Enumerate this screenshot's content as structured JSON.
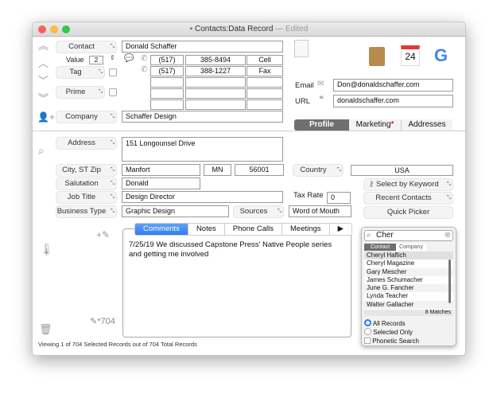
{
  "window": {
    "title": "Contacts:Data Record",
    "edited": "— Edited"
  },
  "nav": {
    "value_label": "Value",
    "value": "2"
  },
  "fields": {
    "contact_label": "Contact",
    "contact": "Donald Schaffer",
    "tag_label": "Tag",
    "prime_label": "Prime",
    "company_label": "Company",
    "company": "Schaffer Design",
    "phones": [
      {
        "area": "(517)",
        "number": "385-8494",
        "type": "Cell"
      },
      {
        "area": "(517)",
        "number": "388-1227",
        "type": "Fax"
      }
    ],
    "email_label": "Email",
    "email": "Don@donaldschaffer.com",
    "url_label": "URL",
    "url": "donaldschaffer.com",
    "address_label": "Address",
    "address": "151 Longounsel Drive",
    "city_label": "City, ST Zip",
    "city": "Manfort",
    "state": "MN",
    "zip": "56001",
    "country_label": "Country",
    "country": "USA",
    "salutation_label": "Salutation",
    "salutation": "Donald",
    "jobtitle_label": "Job Title",
    "jobtitle": "Design Director",
    "taxrate_label": "Tax Rate",
    "taxrate": "0",
    "business_label": "Business Type",
    "business": "Graphic Design",
    "sources_label": "Sources",
    "sources": "Word of Mouth"
  },
  "icons": {
    "calendar_day": "24"
  },
  "tabs": {
    "profile": "Profile",
    "marketing": "Marketing",
    "marketing_mark": "*",
    "addresses": "Addresses"
  },
  "right_buttons": {
    "keyword": "Select by Keyword",
    "recent": "Recent Contacts",
    "picker": "Quick Picker"
  },
  "notes_tabs": [
    "Comments",
    "Notes",
    "Phone Calls",
    "Meetings",
    "▶"
  ],
  "comment": "7/25/19 We discussed Capstone Press' Native People series and getting me involved",
  "record_count": "704",
  "status": "Viewing 1 of 704 Selected Records out of 704 Total Records",
  "picker": {
    "search": "Cher",
    "tabs": [
      "Contact",
      "Company"
    ],
    "items": [
      "Cheryl Haflich",
      "Cheryl Magazine",
      "Gary Mescher",
      "James Schumacher",
      "June G. Fancher",
      "Lynda Teacher",
      "Walter Gallacher"
    ],
    "matches": "8 Matches",
    "radio_all": "All Records",
    "radio_selected": "Selected Only",
    "phonetic": "Phonetic Search"
  },
  "colors": {
    "accent": "#2f7cf6",
    "tab_selected": "#6f6f6f",
    "asterisk": "#e0242b"
  }
}
